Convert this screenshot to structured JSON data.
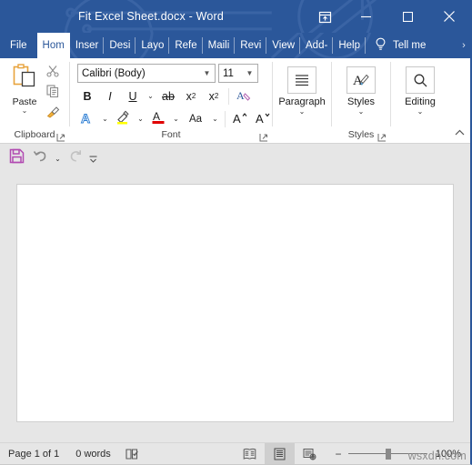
{
  "window": {
    "title": "Fit Excel Sheet.docx  -  Word",
    "accent_color": "#2b579a",
    "buttons": {
      "ribbon_display_options": "Ribbon Display Options",
      "minimize": "Minimize",
      "restore": "Restore Down",
      "close": "Close"
    }
  },
  "tabs": {
    "items": [
      {
        "label": "File",
        "active": false
      },
      {
        "label": "Hom",
        "active": true
      },
      {
        "label": "Inser",
        "active": false
      },
      {
        "label": "Desi",
        "active": false
      },
      {
        "label": "Layo",
        "active": false
      },
      {
        "label": "Refe",
        "active": false
      },
      {
        "label": "Maili",
        "active": false
      },
      {
        "label": "Revi",
        "active": false
      },
      {
        "label": "View",
        "active": false
      },
      {
        "label": "Add-",
        "active": false
      },
      {
        "label": "Help",
        "active": false
      }
    ],
    "tell_me": "Tell me",
    "more_tabs": "›"
  },
  "ribbon": {
    "clipboard": {
      "group_label": "Clipboard",
      "paste_label": "Paste",
      "cut_label": "Cut",
      "copy_label": "Copy",
      "format_painter_label": "Format Painter",
      "dialog_launcher": "Clipboard settings"
    },
    "font": {
      "group_label": "Font",
      "font_name": "Calibri (Body)",
      "font_size": "11",
      "bold": "B",
      "italic": "I",
      "underline": "U",
      "strikethrough": "ab",
      "subscript": "x",
      "subscript_index": "2",
      "superscript": "x",
      "superscript_index": "2",
      "clear_formatting": "Clear All Formatting",
      "text_effects": "A",
      "text_highlight": "Text Highlight Color",
      "font_color": "A",
      "change_case": "Aa",
      "grow_font": "A",
      "shrink_font": "A",
      "dialog_launcher": "Font settings"
    },
    "paragraph": {
      "label": "Paragraph"
    },
    "styles": {
      "button_label": "Styles",
      "group_label": "Styles",
      "dialog_launcher": "Styles settings"
    },
    "editing": {
      "label": "Editing"
    },
    "collapse": "Collapse the Ribbon"
  },
  "quick_access": {
    "save": "Save",
    "undo": "Undo",
    "redo": "Redo",
    "customize": "Customize Quick Access Toolbar",
    "save_color": "#b14ab1"
  },
  "document": {
    "page_background": "#ffffff"
  },
  "status_bar": {
    "page": "Page 1 of 1",
    "words": "0 words",
    "proofing": "Proofing errors",
    "read_mode": "Read Mode",
    "print_layout": "Print Layout",
    "web_layout": "Web Layout",
    "zoom_out": "−",
    "zoom_in": "+",
    "zoom_level": "100%"
  },
  "overlay": {
    "watermark": "wsxdn.com"
  }
}
